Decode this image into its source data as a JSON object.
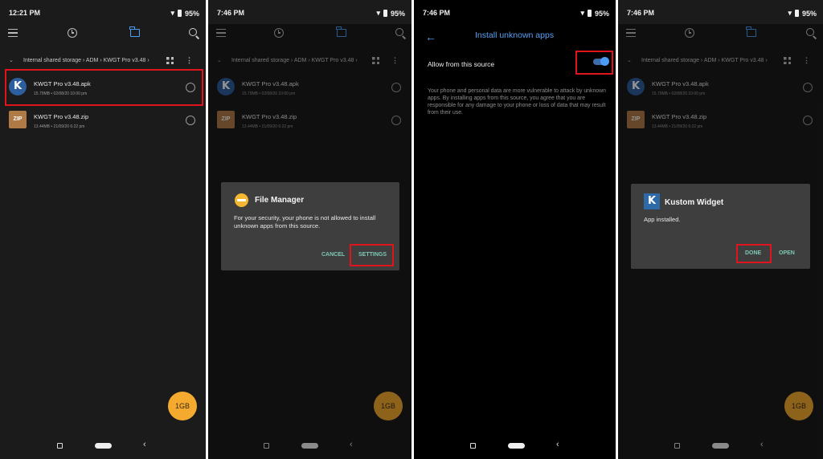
{
  "panels": [
    {
      "status": {
        "time": "12:21 PM",
        "battery": "95%"
      },
      "breadcrumb": "Internal shared storage › ADM › KWGT Pro v3.48 ›",
      "files": [
        {
          "icon": "K",
          "name": "KWGT Pro v3.48.apk",
          "meta": "15.79MB • 02/08/20 10:00 pm"
        },
        {
          "icon": "ZIP",
          "name": "KWGT Pro v3.48.zip",
          "meta": "13.44MB • 21/09/20 6:22 pm"
        }
      ],
      "storage_fab": "1GB"
    },
    {
      "status": {
        "time": "7:46 PM",
        "battery": "95%"
      },
      "breadcrumb": "Internal shared storage › ADM › KWGT Pro v3.48 ›",
      "files": [
        {
          "icon": "K",
          "name": "KWGT Pro v3.48.apk",
          "meta": "15.79MB • 02/08/20 10:00 pm"
        },
        {
          "icon": "ZIP",
          "name": "KWGT Pro v3.48.zip",
          "meta": "13.44MB • 21/09/20 6:22 pm"
        }
      ],
      "storage_fab": "1GB",
      "dialog": {
        "title": "File Manager",
        "message": "For your security, your phone is not allowed to install unknown apps from this source.",
        "cancel": "CANCEL",
        "settings": "SETTINGS"
      }
    },
    {
      "status": {
        "time": "7:46 PM",
        "battery": "95%"
      },
      "title": "Install unknown apps",
      "allow_label": "Allow from this source",
      "allow_enabled": true,
      "warning": "Your phone and personal data are more vulnerable to attack by unknown apps. By installing apps from this source, you agree that you are responsible for any damage to your phone or loss of data that may result from their use."
    },
    {
      "status": {
        "time": "7:46 PM",
        "battery": "95%"
      },
      "breadcrumb": "Internal shared storage › ADM › KWGT Pro v3.48 ›",
      "files": [
        {
          "icon": "K",
          "name": "KWGT Pro v3.48.apk",
          "meta": "15.79MB • 02/08/20 10:00 pm"
        },
        {
          "icon": "ZIP",
          "name": "KWGT Pro v3.48.zip",
          "meta": "13.44MB • 21/09/20 6:22 pm"
        }
      ],
      "storage_fab": "1GB",
      "dialog": {
        "app_icon": "K",
        "title": "Kustom Widget",
        "message": "App installed.",
        "done": "DONE",
        "open": "OPEN"
      }
    }
  ],
  "colors": {
    "accent_blue": "#4a9ff5",
    "fab_orange": "#f3aa2e",
    "highlight_red": "#e0141c",
    "dialog_button": "#7fc7b3"
  },
  "icons": [
    "menu-icon",
    "recent-clock-icon",
    "folder-icon",
    "search-icon",
    "chevron-down-icon",
    "grid-view-icon",
    "more-vert-icon",
    "back-arrow-icon"
  ]
}
